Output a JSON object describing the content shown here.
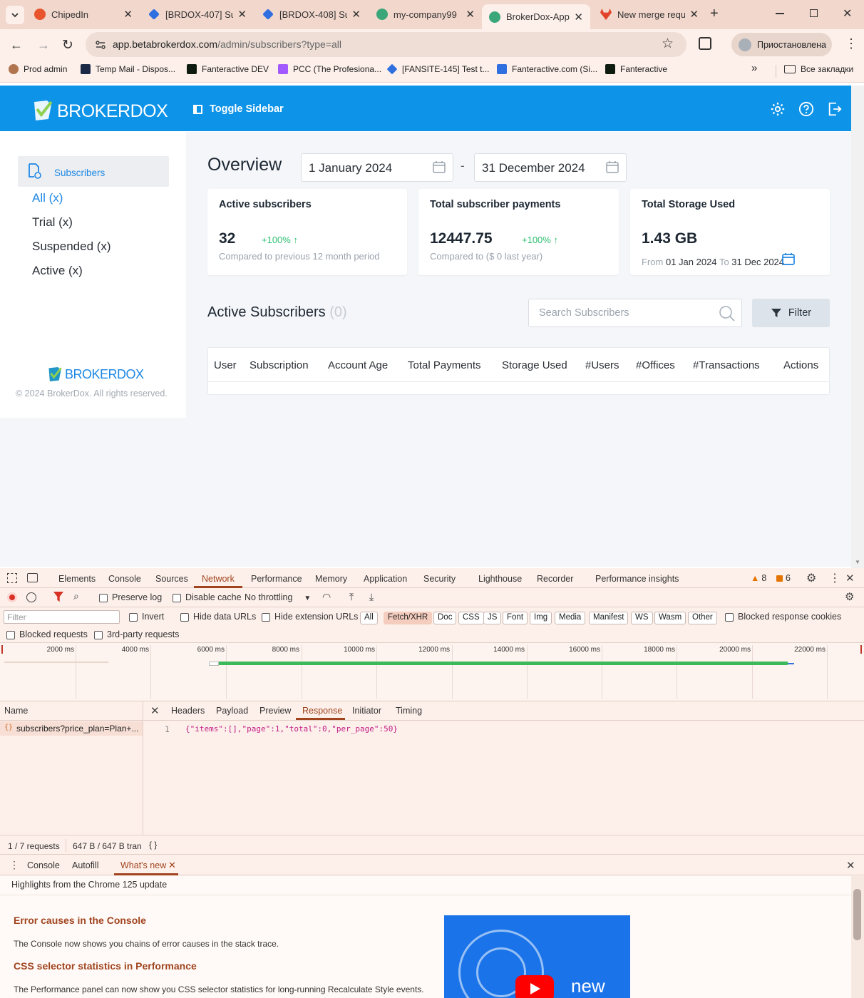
{
  "browser": {
    "tabs": [
      {
        "label": "ChipedIn",
        "color": "#e8542c"
      },
      {
        "label": "[BRDOX-407] Su",
        "color": "#2f6fe0"
      },
      {
        "label": "[BRDOX-408] Su",
        "color": "#2f6fe0"
      },
      {
        "label": "my-company99",
        "color": "#3aa67a"
      },
      {
        "label": "BrokerDox-App",
        "color": "#3aa67a"
      },
      {
        "label": "New merge requ",
        "color": "#e2432b"
      }
    ],
    "url_host": "app.betabrokerdox.com",
    "url_path": "/admin/subscribers?type=all",
    "profile_label": "Приостановлена",
    "bookmarks": [
      {
        "label": "Prod admin",
        "color": "#b0744f"
      },
      {
        "label": "Temp Mail - Dispos...",
        "color": "#1a2a46"
      },
      {
        "label": "Fanteractive DEV",
        "color": "#0e1c10"
      },
      {
        "label": "PCC (The Profesiona...",
        "color": "#a259ff"
      },
      {
        "label": "[FANSITE-145] Test t...",
        "color": "#2f6fe0"
      },
      {
        "label": "Fanteractive.com (Si...",
        "color": "#2f6fe0"
      },
      {
        "label": "Fanteractive",
        "color": "#0e1c10"
      }
    ],
    "more_bookmarks": "»",
    "all_bookmarks": "Все закладки"
  },
  "app": {
    "brand": "BROKERDOX",
    "toggle_sidebar": "Toggle Sidebar",
    "sidebar": {
      "section": "Subscribers",
      "items": [
        "All (x)",
        "Trial (x)",
        "Suspended (x)",
        "Active (x)"
      ],
      "footer_brand": "BROKERDOX",
      "copyright": "© 2024 BrokerDox. All rights reserved."
    },
    "overview": {
      "title": "Overview",
      "date_from": "1 January 2024",
      "date_sep": "-",
      "date_to": "31 December 2024"
    },
    "cards": {
      "active": {
        "title": "Active subscribers",
        "value": "32",
        "change": "+100% ↑",
        "note": "Compared to previous 12 month period"
      },
      "payments": {
        "title": "Total subscriber payments",
        "value": "12447.75",
        "change": "+100% ↑",
        "note": "Compared to ($ 0 last year)"
      },
      "storage": {
        "title": "Total Storage Used",
        "value": "1.43 GB",
        "from_word": "From",
        "from_date": "01 Jan 2024",
        "to_word": "To",
        "to_date": "31 Dec 2024"
      }
    },
    "list": {
      "title": "Active Subscribers",
      "count": "(0)",
      "search_placeholder": "Search Subscribers",
      "filter_label": "Filter",
      "columns": [
        "User",
        "Subscription",
        "Account Age",
        "Total Payments",
        "Storage Used",
        "#Users",
        "#Offices",
        "#Transactions",
        "Actions"
      ]
    }
  },
  "devtools": {
    "tabs": [
      "Elements",
      "Console",
      "Sources",
      "Network",
      "Performance",
      "Memory",
      "Application",
      "Security",
      "Lighthouse",
      "Recorder",
      "Performance insights"
    ],
    "active_tab": "Network",
    "warnings": "8",
    "issues": "6",
    "preserve_log": "Preserve log",
    "disable_cache": "Disable cache",
    "throttling": "No throttling",
    "filter_placeholder": "Filter",
    "invert": "Invert",
    "hide_data_urls": "Hide data URLs",
    "hide_ext_urls": "Hide extension URLs",
    "type_chips": [
      "All",
      "Fetch/XHR",
      "Doc",
      "CSS",
      "JS",
      "Font",
      "Img",
      "Media",
      "Manifest",
      "WS",
      "Wasm",
      "Other"
    ],
    "active_chip": "Fetch/XHR",
    "blocked_cookies": "Blocked response cookies",
    "blocked_requests": "Blocked requests",
    "third_party": "3rd-party requests",
    "timeline_ticks": [
      "2000 ms",
      "4000 ms",
      "6000 ms",
      "8000 ms",
      "10000 ms",
      "12000 ms",
      "14000 ms",
      "16000 ms",
      "18000 ms",
      "20000 ms",
      "22000 ms"
    ],
    "name_header": "Name",
    "request_name": "subscribers?price_plan=Plan+...",
    "detail_tabs": [
      "Headers",
      "Payload",
      "Preview",
      "Response",
      "Initiator",
      "Timing"
    ],
    "active_detail": "Response",
    "line_no": "1",
    "response_body": "{\"items\":[],\"page\":1,\"total\":0,\"per_page\":50}",
    "status_requests": "1 / 7 requests",
    "status_transfer": "647 B / 647 B tran",
    "drawer_tabs": [
      "Console",
      "Autofill",
      "What's new"
    ],
    "drawer_active": "What's new",
    "whatsnew_header": "Highlights from the Chrome 125 update",
    "h1": "Error causes in the Console",
    "p1": "The Console now shows you chains of error causes in the stack trace.",
    "h2": "CSS selector statistics in Performance",
    "p2": "The Performance panel can now show you CSS selector statistics for long-running Recalculate Style events.",
    "video_caption": "new"
  },
  "colors": {
    "brand_blue": "#0d93e8",
    "green": "#2fbf71",
    "link_blue": "#1e88e5",
    "devtools_accent": "#a0441f"
  }
}
